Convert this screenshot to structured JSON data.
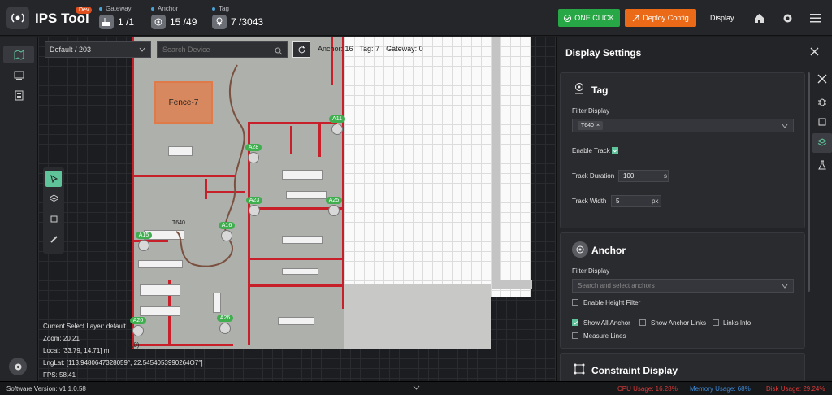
{
  "app": {
    "title": "IPS Tool",
    "badge": "Dev"
  },
  "stats": {
    "gateway": {
      "label": "Gateway",
      "value": "1 /1"
    },
    "anchor": {
      "label": "Anchor",
      "value": "15 /49"
    },
    "tag": {
      "label": "Tag",
      "value": "7 /3043"
    }
  },
  "toolbar": {
    "one_click": "ONE CLICK",
    "deploy": "Deploy Config",
    "display": "Display"
  },
  "map": {
    "layer": "Default / 203",
    "search_placeholder": "Search Device",
    "counts": {
      "anchor": "Anchor: 16",
      "tag": "Tag: 7",
      "gateway": "Gateway: 0"
    },
    "fence": "Fence-7",
    "tag_label": "T640",
    "origin": "(0,0)",
    "anchors": [
      "A11",
      "A28",
      "A23",
      "A25",
      "A16",
      "A15",
      "A20",
      "A26"
    ]
  },
  "info": {
    "layer": "Current Select Layer:  default",
    "zoom": "Zoom:  20.21",
    "local": "Local:  [33.79, 14.71] m",
    "lnglat": "LngLat:  [113.9480647328059°, 22.5454053990264O7°]",
    "fps": "FPS:  58.41"
  },
  "panel": {
    "title": "Display Settings",
    "tag": {
      "title": "Tag",
      "filter_label": "Filter Display",
      "chip": "T640",
      "enable_track": "Enable Track",
      "enable_track_on": true,
      "track_duration_label": "Track Duration",
      "track_duration": "100",
      "track_duration_unit": "s",
      "track_width_label": "Track Width",
      "track_width": "5",
      "track_width_unit": "px"
    },
    "anchor": {
      "title": "Anchor",
      "filter_label": "Filter Display",
      "filter_placeholder": "Search and select anchors",
      "height_filter": "Enable Height Filter",
      "show_all": "Show All Anchor",
      "show_links": "Show Anchor Links",
      "links_info": "Links Info",
      "measure_lines": "Measure Lines"
    },
    "constraint": {
      "title": "Constraint Display"
    }
  },
  "status": {
    "version": "Software Version:  v1.1.0.58",
    "cpu": "CPU Usage:  16.28%",
    "memory": "Memory Usage:  68%",
    "disk": "Disk Usage:  29.24%"
  },
  "colors": {
    "accent": "#5fc49a",
    "green": "#27a745",
    "orange": "#ea6a18",
    "wall": "#c8202a"
  }
}
